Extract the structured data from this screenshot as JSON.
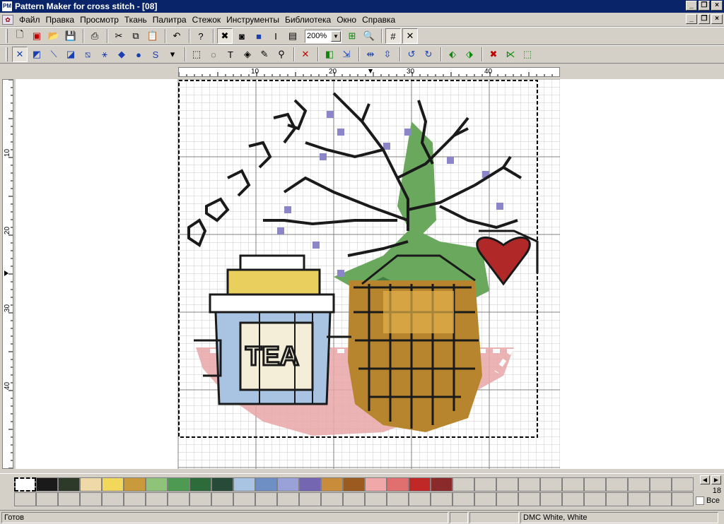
{
  "window": {
    "title": "Pattern Maker for cross stitch - [08]",
    "icon": "PM"
  },
  "menu": [
    "Файл",
    "Правка",
    "Просмотр",
    "Ткань",
    "Палитра",
    "Стежок",
    "Инструменты",
    "Библиотека",
    "Окно",
    "Справка"
  ],
  "toolbar": {
    "zoom": "200%"
  },
  "ruler": {
    "h": [
      "10",
      "20",
      "30",
      "40"
    ],
    "v": [
      "10",
      "20",
      "30",
      "40"
    ]
  },
  "chart_text": {
    "tea": "TEA"
  },
  "palette": {
    "colors": [
      "#ffffff",
      "#1a1a1a",
      "#2d3a2a",
      "#f0d9a8",
      "#f1d85a",
      "#c99a3c",
      "#8fc37a",
      "#4f9a52",
      "#2e6b3a",
      "#284a38",
      "#a9c4e2",
      "#6d8fc4",
      "#9aa0d8",
      "#7466b0",
      "#c88c3a",
      "#9a5a20",
      "#f0a8a8",
      "#e07070",
      "#c02828",
      "#8a2a2a"
    ],
    "page": "18",
    "all_label": "Все"
  },
  "status": {
    "text": "Готов",
    "thread": "DMC  White, White"
  }
}
